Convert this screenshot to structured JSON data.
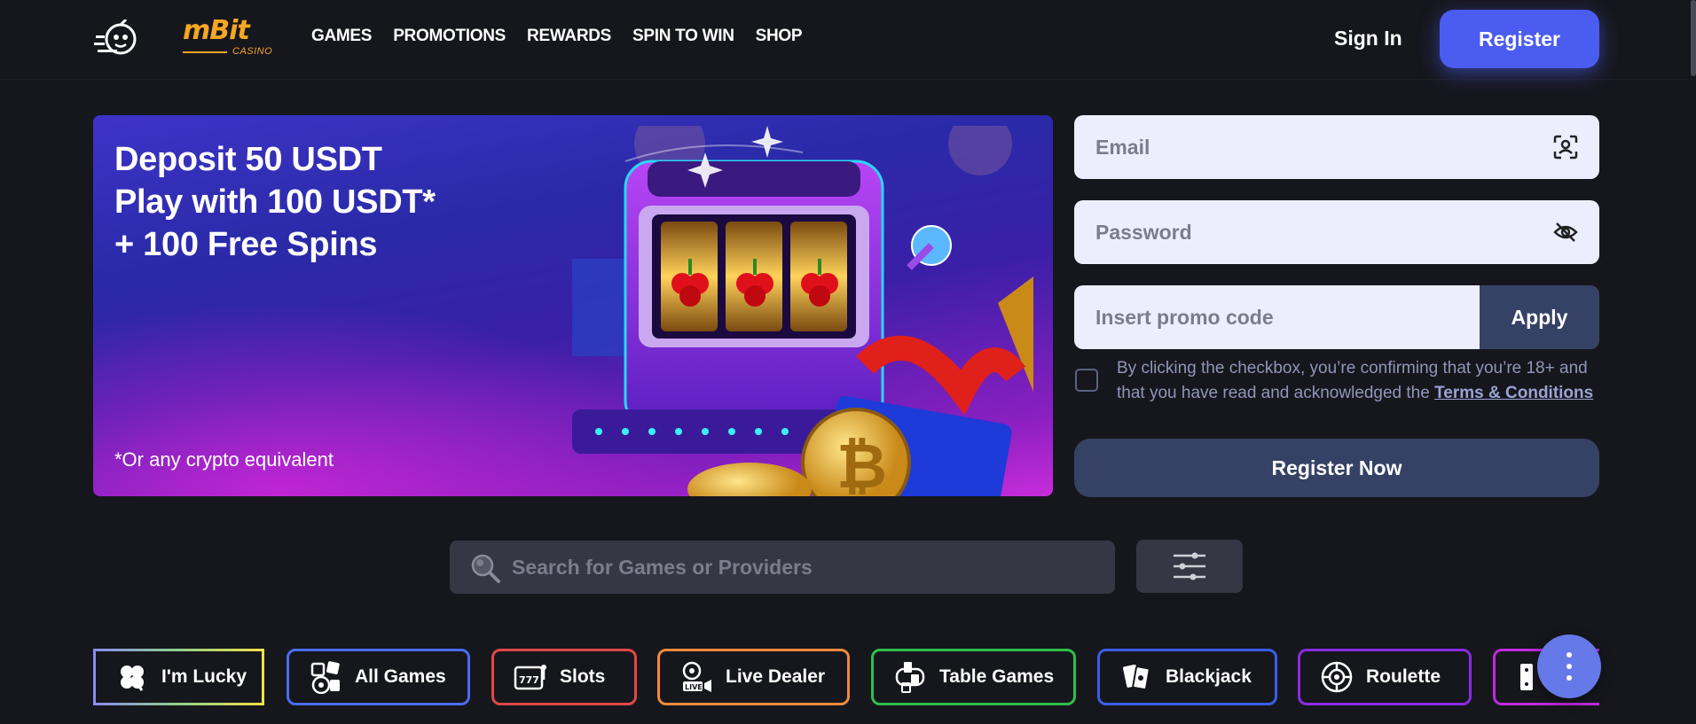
{
  "header": {
    "brand": "mBit",
    "brand_sub": "CASINO",
    "nav": [
      "GAMES",
      "PROMOTIONS",
      "REWARDS",
      "SPIN TO WIN",
      "SHOP"
    ],
    "signin_label": "Sign In",
    "register_label": "Register"
  },
  "banner": {
    "line1": "Deposit 50 USDT",
    "line2": "Play with 100 USDT*",
    "line3": "+ 100 Free Spins",
    "note": "*Or any crypto equivalent"
  },
  "form": {
    "email_placeholder": "Email",
    "password_placeholder": "Password",
    "promo_placeholder": "Insert promo code",
    "apply_label": "Apply",
    "terms_text": "By clicking the checkbox, you’re confirming that you’re 18+ and that you have read and acknowledged the ",
    "terms_link": "Terms & Conditions",
    "register_now_label": "Register Now"
  },
  "search": {
    "placeholder": "Search for Games or Providers"
  },
  "categories": [
    {
      "label": "I'm Lucky",
      "icon": "clover-icon",
      "color": "#8fd18a"
    },
    {
      "label": "All Games",
      "icon": "dice-chips-icon",
      "color": "#4a6cf0"
    },
    {
      "label": "Slots",
      "icon": "slot-machine-icon",
      "color": "#e04848"
    },
    {
      "label": "Live Dealer",
      "icon": "live-dealer-icon",
      "color": "#f08a3c"
    },
    {
      "label": "Table Games",
      "icon": "table-games-icon",
      "color": "#2fbf4a"
    },
    {
      "label": "Blackjack",
      "icon": "cards-icon",
      "color": "#3a5ee8"
    },
    {
      "label": "Roulette",
      "icon": "roulette-icon",
      "color": "#8a2be2"
    }
  ],
  "colors": {
    "accent": "#4b5cf0",
    "brand": "#f5a623",
    "background": "#16171d"
  }
}
